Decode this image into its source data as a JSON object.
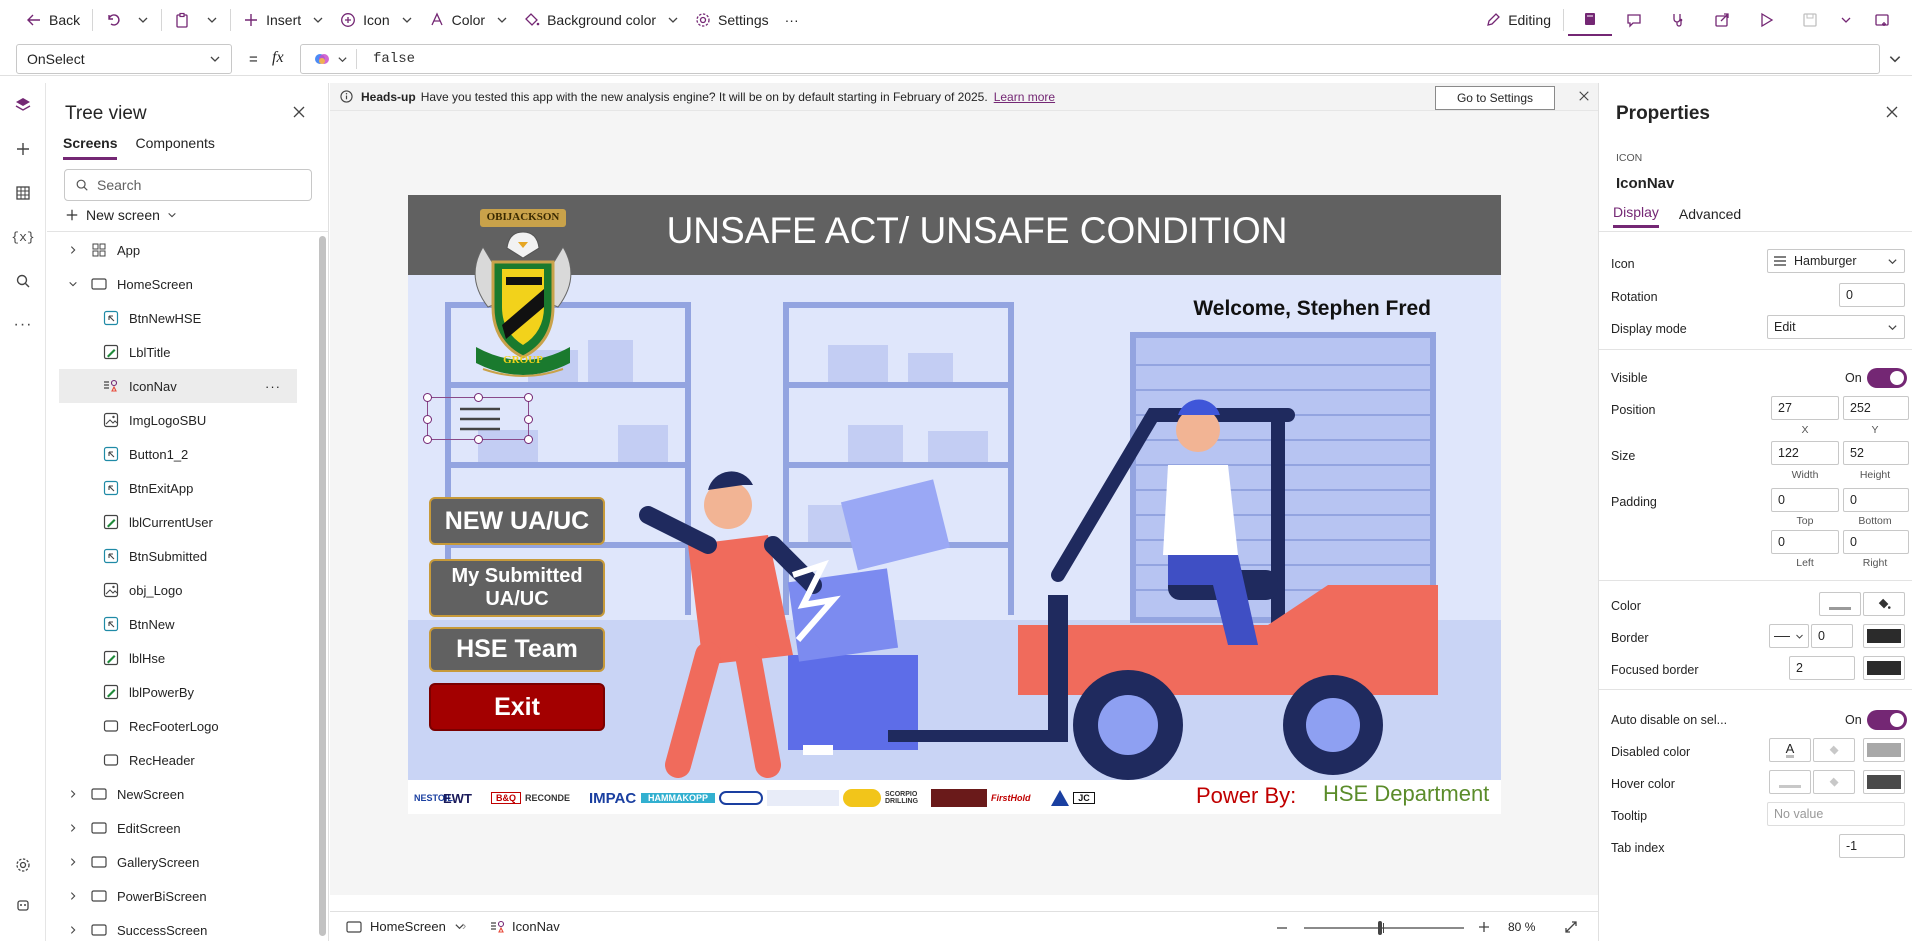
{
  "toolbar": {
    "back": "Back",
    "insert": "Insert",
    "icon": "Icon",
    "color": "Color",
    "background_color": "Background color",
    "settings": "Settings",
    "more": "···",
    "editing": "Editing"
  },
  "formula": {
    "property": "OnSelect",
    "equals": "=",
    "fx": "fx",
    "value": "false"
  },
  "tree": {
    "title": "Tree view",
    "tabs": [
      "Screens",
      "Components"
    ],
    "search_placeholder": "Search",
    "new_screen": "New screen",
    "items": [
      {
        "label": "App",
        "icon": "app-icon",
        "level": 0,
        "expand": "right"
      },
      {
        "label": "HomeScreen",
        "icon": "screen-icon",
        "level": 0,
        "expand": "down"
      },
      {
        "label": "BtnNewHSE",
        "icon": "button-icon",
        "level": 1
      },
      {
        "label": "LblTitle",
        "icon": "label-icon",
        "level": 1
      },
      {
        "label": "IconNav",
        "icon": "icon-control-icon",
        "level": 1,
        "selected": true
      },
      {
        "label": "ImgLogoSBU",
        "icon": "image-icon",
        "level": 1
      },
      {
        "label": "Button1_2",
        "icon": "button-icon",
        "level": 1
      },
      {
        "label": "BtnExitApp",
        "icon": "button-icon",
        "level": 1
      },
      {
        "label": "lblCurrentUser",
        "icon": "label-icon",
        "level": 1
      },
      {
        "label": "BtnSubmitted",
        "icon": "button-icon",
        "level": 1
      },
      {
        "label": "obj_Logo",
        "icon": "image-icon",
        "level": 1
      },
      {
        "label": "BtnNew",
        "icon": "button-icon",
        "level": 1
      },
      {
        "label": "lblHse",
        "icon": "label-icon",
        "level": 1
      },
      {
        "label": "lblPowerBy",
        "icon": "label-icon",
        "level": 1
      },
      {
        "label": "RecFooterLogo",
        "icon": "rectangle-icon",
        "level": 1
      },
      {
        "label": "RecHeader",
        "icon": "rectangle-icon",
        "level": 1
      },
      {
        "label": "NewScreen",
        "icon": "screen-icon",
        "level": 0,
        "expand": "right"
      },
      {
        "label": "EditScreen",
        "icon": "screen-icon",
        "level": 0,
        "expand": "right"
      },
      {
        "label": "GalleryScreen",
        "icon": "screen-icon",
        "level": 0,
        "expand": "right"
      },
      {
        "label": "PowerBiScreen",
        "icon": "screen-icon",
        "level": 0,
        "expand": "right"
      },
      {
        "label": "SuccessScreen",
        "icon": "screen-icon",
        "level": 0,
        "expand": "right"
      }
    ]
  },
  "banner": {
    "title": "Heads-up",
    "text": "Have you tested this app with the new analysis engine? It will be on by default starting in February of 2025.",
    "link": "Learn more",
    "button": "Go to Settings"
  },
  "app": {
    "title": "UNSAFE ACT/ UNSAFE CONDITION",
    "welcome": "Welcome, Stephen Fred",
    "logo_top": "OBIJACKSON",
    "logo_bottom": "GROUP",
    "btn_new": "NEW UA/UC",
    "btn_submitted": "My Submitted UA/UC",
    "btn_team": "HSE Team",
    "btn_exit": "Exit",
    "power_by": "Power By:",
    "department": "HSE Department",
    "footer_logos": [
      "NESTOIL",
      "EWT",
      "B&Q",
      "RECONDE",
      "IMPAC",
      "HAMMAKOPP",
      "",
      "",
      "",
      "SCORPIO DRILLING",
      "",
      "FirstHold",
      "",
      "JC"
    ]
  },
  "status": {
    "screen": "HomeScreen",
    "control": "IconNav",
    "zoom": "80",
    "zoom_unit": "%",
    "zoom_level": 0.8
  },
  "props": {
    "title": "Properties",
    "type": "ICON",
    "name": "IconNav",
    "tabs": [
      "Display",
      "Advanced"
    ],
    "icon_label": "Icon",
    "icon_value": "Hamburger",
    "rotation_label": "Rotation",
    "rotation": "0",
    "display_mode_label": "Display mode",
    "display_mode": "Edit",
    "visible_label": "Visible",
    "visible": "On",
    "position_label": "Position",
    "x": "27",
    "y": "252",
    "x_label": "X",
    "y_label": "Y",
    "size_label": "Size",
    "width": "122",
    "height": "52",
    "width_label": "Width",
    "height_label": "Height",
    "padding_label": "Padding",
    "pad_top": "0",
    "pad_bottom": "0",
    "pad_left": "0",
    "pad_right": "0",
    "top_label": "Top",
    "bottom_label": "Bottom",
    "left_label": "Left",
    "right_label": "Right",
    "color_label": "Color",
    "border_label": "Border",
    "border_width": "0",
    "focused_border_label": "Focused border",
    "focused_border": "2",
    "auto_disable_label": "Auto disable on sel...",
    "auto_disable": "On",
    "disabled_color_label": "Disabled color",
    "hover_color_label": "Hover color",
    "tooltip_label": "Tooltip",
    "tooltip_placeholder": "No value",
    "tab_index_label": "Tab index",
    "tab_index": "-1"
  },
  "colors": {
    "accent": "#742774",
    "header": "#616161",
    "exit": "#a30000",
    "power_by": "#c00000",
    "department": "#5b8c2a"
  }
}
